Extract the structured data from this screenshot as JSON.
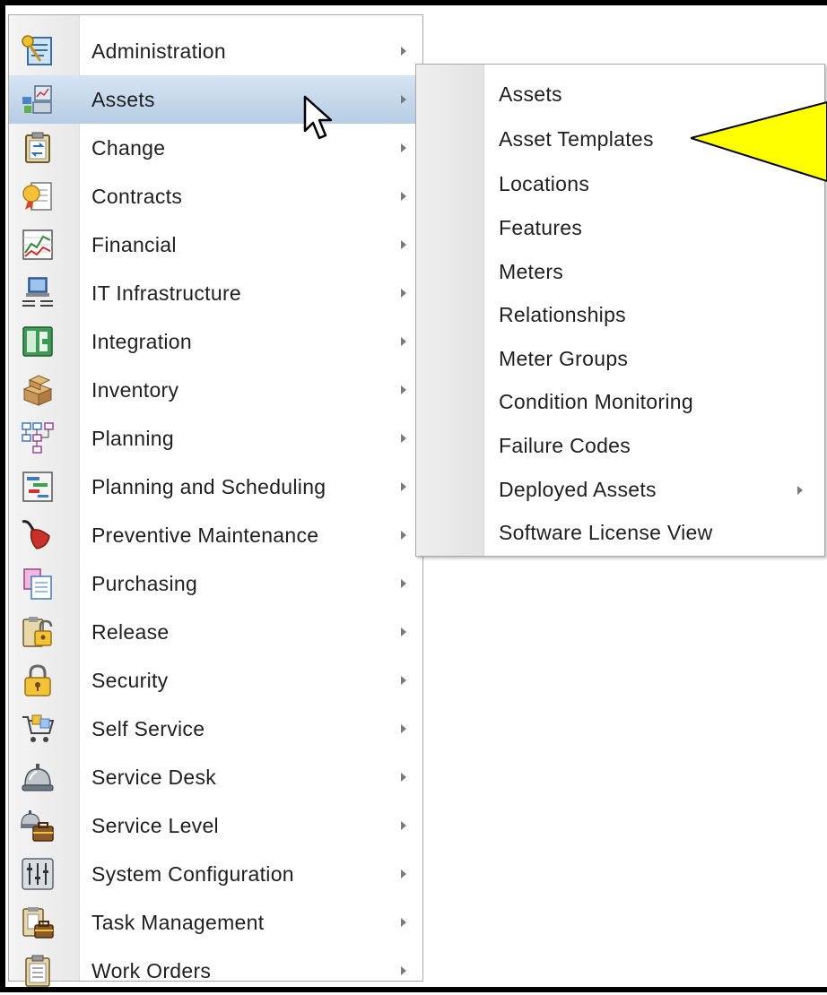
{
  "main_menu": {
    "items": [
      {
        "label": "Administration",
        "icon": "admin-icon"
      },
      {
        "label": "Assets",
        "icon": "assets-icon"
      },
      {
        "label": "Change",
        "icon": "change-icon"
      },
      {
        "label": "Contracts",
        "icon": "contracts-icon"
      },
      {
        "label": "Financial",
        "icon": "financial-icon"
      },
      {
        "label": "IT Infrastructure",
        "icon": "it-infrastructure-icon"
      },
      {
        "label": "Integration",
        "icon": "integration-icon"
      },
      {
        "label": "Inventory",
        "icon": "inventory-icon"
      },
      {
        "label": "Planning",
        "icon": "planning-icon"
      },
      {
        "label": "Planning and Scheduling",
        "icon": "planning-scheduling-icon"
      },
      {
        "label": "Preventive Maintenance",
        "icon": "preventive-maintenance-icon"
      },
      {
        "label": "Purchasing",
        "icon": "purchasing-icon"
      },
      {
        "label": "Release",
        "icon": "release-icon"
      },
      {
        "label": "Security",
        "icon": "security-icon"
      },
      {
        "label": "Self Service",
        "icon": "self-service-icon"
      },
      {
        "label": "Service Desk",
        "icon": "service-desk-icon"
      },
      {
        "label": "Service Level",
        "icon": "service-level-icon"
      },
      {
        "label": "System Configuration",
        "icon": "system-configuration-icon"
      },
      {
        "label": "Task Management",
        "icon": "task-management-icon"
      },
      {
        "label": "Work Orders",
        "icon": "work-orders-icon"
      }
    ],
    "active_item": "Assets"
  },
  "submenu": {
    "items": [
      {
        "label": "Assets"
      },
      {
        "label": "Asset Templates"
      },
      {
        "label": "Locations"
      },
      {
        "label": "Features"
      },
      {
        "label": "Meters"
      },
      {
        "label": "Relationships"
      },
      {
        "label": "Meter Groups"
      },
      {
        "label": "Condition Monitoring"
      },
      {
        "label": "Failure Codes"
      },
      {
        "label": "Deployed Assets"
      },
      {
        "label": "Software License View"
      }
    ]
  },
  "colors": {
    "active_highlight": "#b6cde4",
    "callout_fill": "#ffff00",
    "text": "#1f1f1f"
  }
}
